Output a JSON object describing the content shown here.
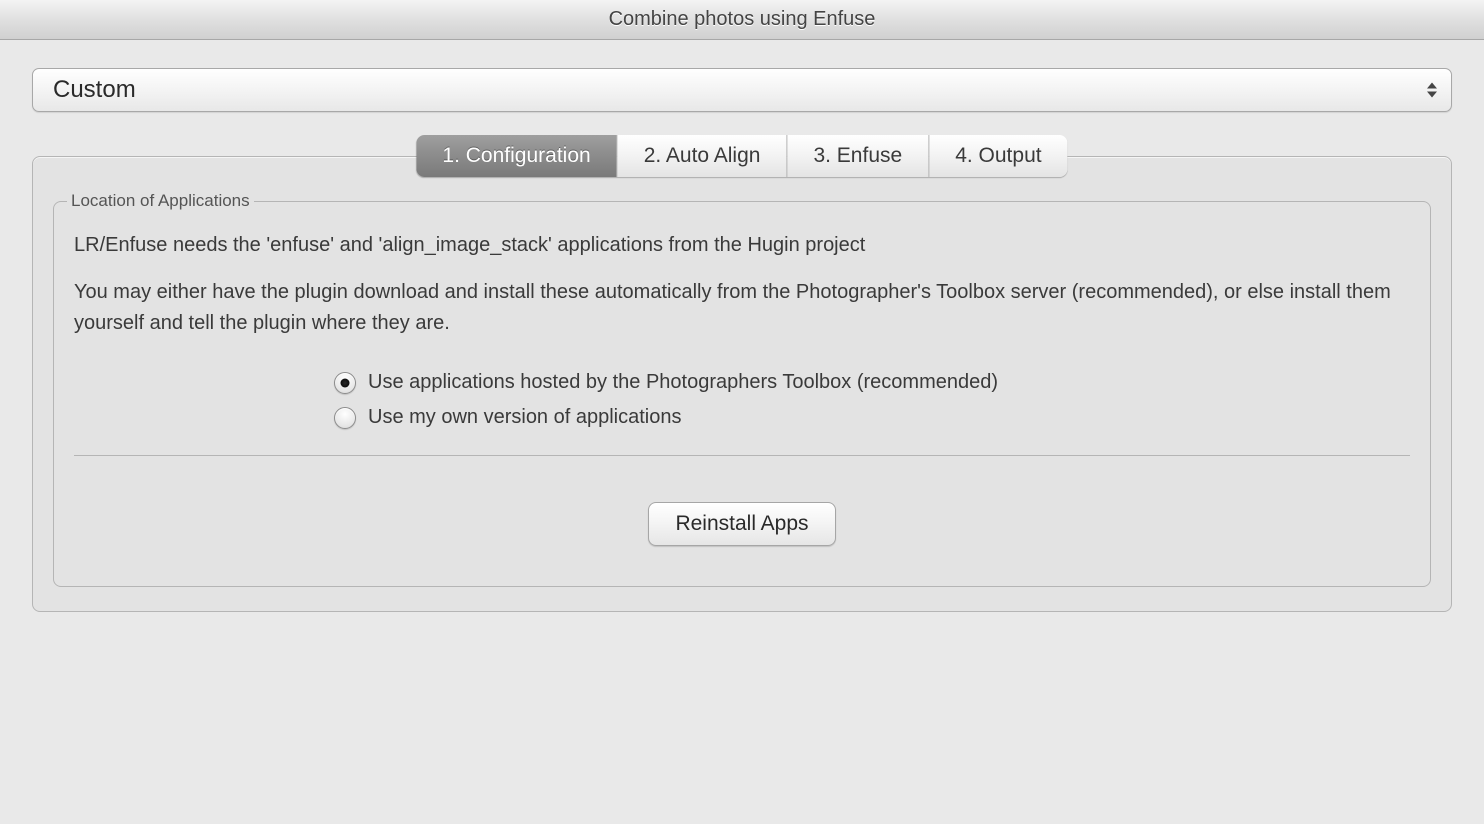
{
  "window": {
    "title": "Combine photos using Enfuse"
  },
  "preset_dropdown": {
    "value": "Custom"
  },
  "tabs": [
    {
      "label": "1. Configuration",
      "active": true
    },
    {
      "label": "2. Auto Align",
      "active": false
    },
    {
      "label": "3. Enfuse",
      "active": false
    },
    {
      "label": "4. Output",
      "active": false
    }
  ],
  "fieldset": {
    "legend": "Location of Applications",
    "paragraph1": "LR/Enfuse needs the 'enfuse' and 'align_image_stack' applications from the Hugin project",
    "paragraph2": "You may either have the plugin download and install these automatically from the Photographer's Toolbox server (recommended), or else install them yourself and tell the plugin where they are.",
    "radios": [
      {
        "label": "Use applications hosted by the Photographers Toolbox (recommended)",
        "selected": true
      },
      {
        "label": "Use my own version of applications",
        "selected": false
      }
    ],
    "reinstall_button": "Reinstall Apps"
  }
}
